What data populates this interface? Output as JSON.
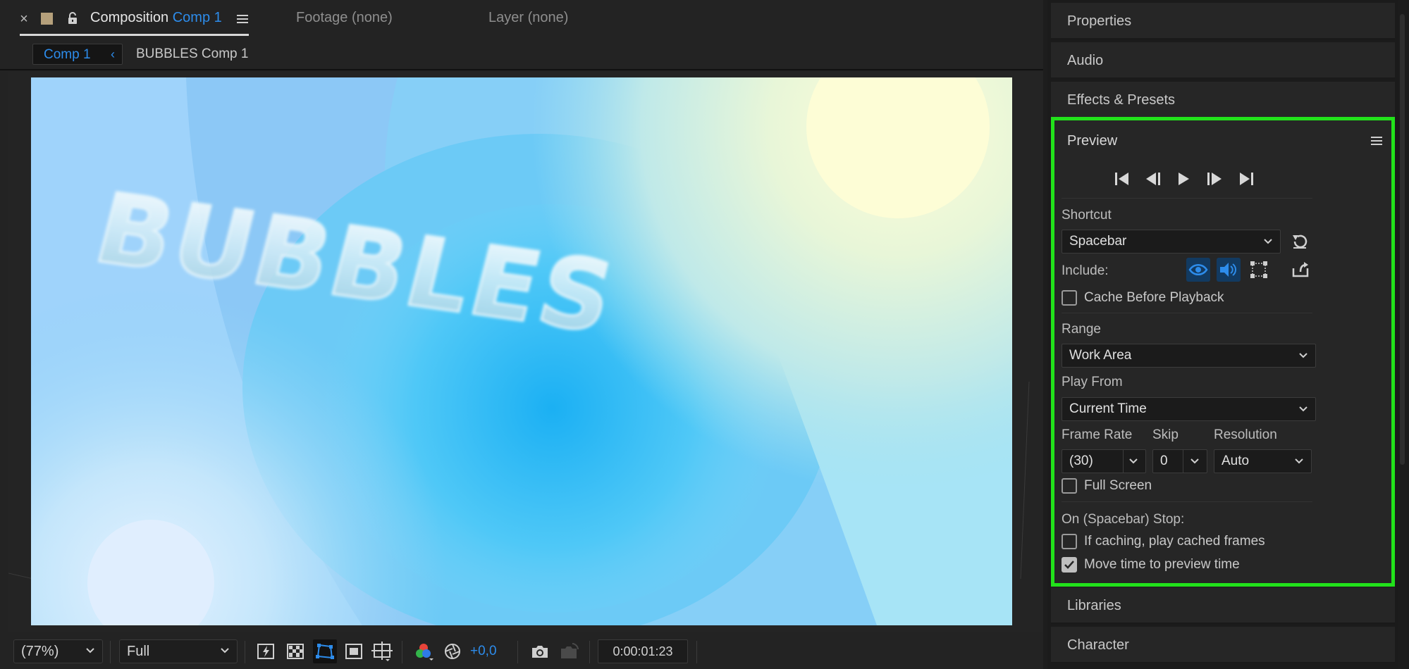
{
  "composition_panel": {
    "tabs": {
      "composition_label": "Composition",
      "composition_name": "Comp 1",
      "footage": "Footage (none)",
      "layer": "Layer (none)"
    },
    "flowchart": {
      "active": "Comp 1",
      "crumb": "BUBBLES Comp 1"
    },
    "viewer": {
      "text": "BUBBLES"
    },
    "toolbar": {
      "zoom": "(77%)",
      "resolution": "Full",
      "exposure": "+0,0",
      "timecode": "0:00:01:23"
    }
  },
  "right_panels": {
    "above": [
      "Properties",
      "Audio",
      "Effects & Presets"
    ],
    "below": [
      "Libraries",
      "Character"
    ]
  },
  "preview": {
    "title": "Preview",
    "shortcut_label": "Shortcut",
    "shortcut_value": "Spacebar",
    "include_label": "Include:",
    "cache_before_playback": "Cache Before Playback",
    "range_label": "Range",
    "range_value": "Work Area",
    "play_from_label": "Play From",
    "play_from_value": "Current Time",
    "frame_rate_label": "Frame Rate",
    "frame_rate_value": "(30)",
    "skip_label": "Skip",
    "skip_value": "0",
    "resolution_label": "Resolution",
    "resolution_value": "Auto",
    "full_screen": "Full Screen",
    "on_stop_label": "On (Spacebar) Stop:",
    "if_caching": "If caching, play cached frames",
    "move_time": "Move time to preview time",
    "checks": {
      "cache_before_playback": false,
      "full_screen": false,
      "if_caching": false,
      "move_time": true
    }
  },
  "colors": {
    "accent_blue": "#2d8ceb",
    "highlight_green": "#22e21b"
  }
}
